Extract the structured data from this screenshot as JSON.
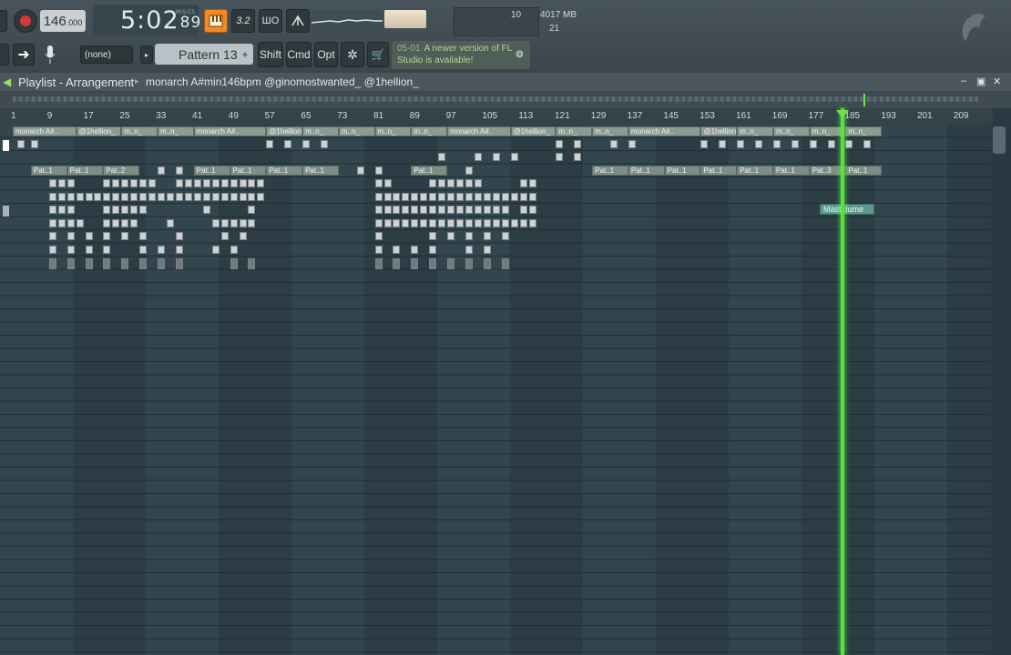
{
  "toolbar": {
    "tempo_value": "146",
    "tempo_decimal": ".000",
    "time_main": "5:02",
    "time_cs": "89",
    "time_format": "M:S:CS",
    "cpu_value": "10",
    "memory": "4017 MB",
    "polyphony": "21",
    "pattern_none": "(none)",
    "pattern_name": "Pattern 13",
    "shift_label": "Shift",
    "cmd_label": "Cmd",
    "opt_label": "Opt",
    "news_date": "05-01",
    "news_text": "A newer version of FL Studio is available!",
    "plus": "+"
  },
  "playlist": {
    "title": "Playlist - Arrangement",
    "project": "monarch A#min146bpm @ginomostwanted_ @1hellion_",
    "ruler_ticks": [
      "1",
      "9",
      "17",
      "25",
      "33",
      "41",
      "49",
      "57",
      "65",
      "73",
      "81",
      "89",
      "97",
      "105",
      "113",
      "121",
      "129",
      "137",
      "145",
      "153",
      "161",
      "169",
      "177",
      "185",
      "193",
      "201",
      "209"
    ],
    "audio_clip_full": "monarch A#..",
    "audio_clip_hellion": "@1hellion_",
    "audio_clip_short": "m..n_",
    "pattern_clip_a": "Pat..1",
    "pattern_clip_b": "Pat..2",
    "pattern_clip_c": "Pat..3",
    "automation_clip": "Mast..lume"
  },
  "icons": [
    "record-icon",
    "piano-icon",
    "mic-icon",
    "arrow-icon",
    "cart-icon",
    "globe-icon",
    "fl-logo-icon",
    "speaker-icon"
  ]
}
